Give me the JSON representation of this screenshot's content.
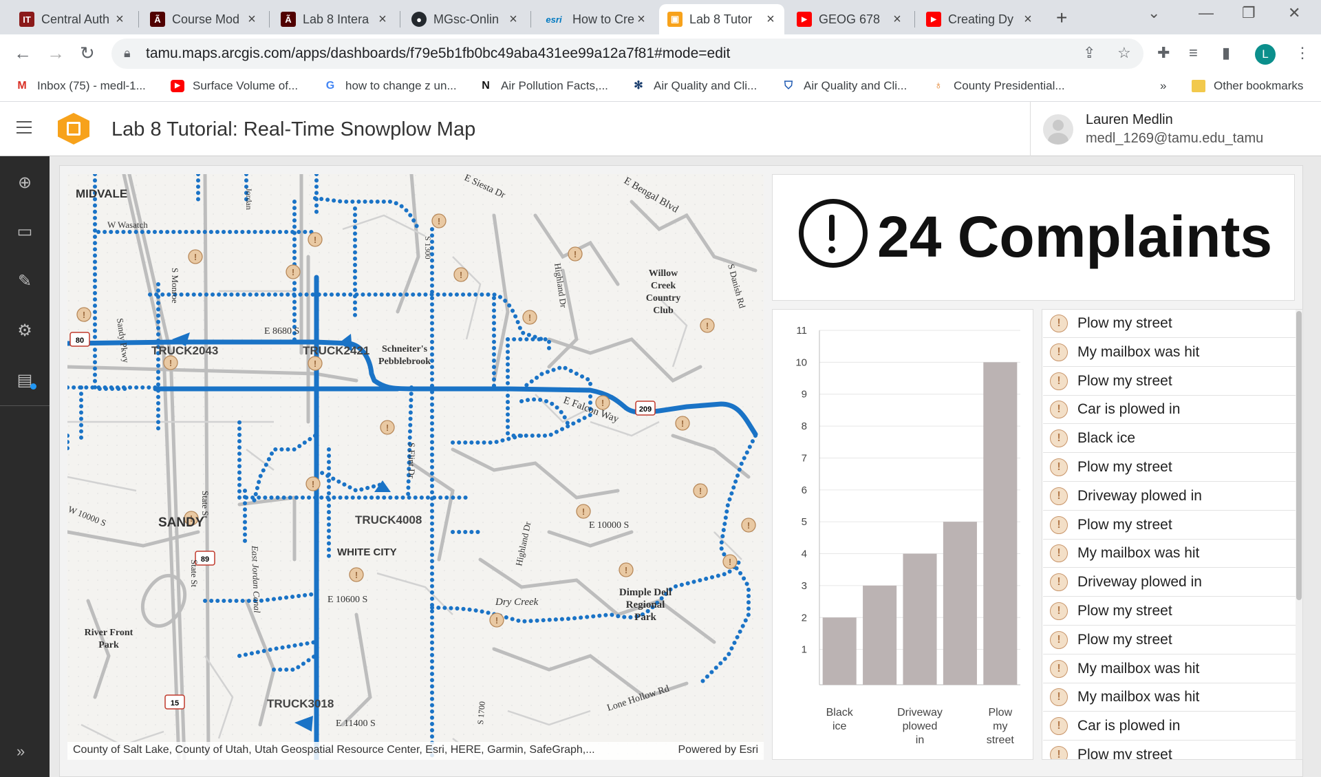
{
  "browser": {
    "tabs": [
      {
        "label": "Central Auth",
        "icon": "it-icon",
        "color": "#8b1a1a"
      },
      {
        "label": "Course Mod",
        "icon": "tamu-icon",
        "color": "#500000"
      },
      {
        "label": "Lab 8 Intera",
        "icon": "tamu-icon",
        "color": "#500000"
      },
      {
        "label": "MGsc-Onlin",
        "icon": "github-icon",
        "color": "#24292e"
      },
      {
        "label": "How to Cre",
        "icon": "esri-icon",
        "color": "#0079c1"
      },
      {
        "label": "Lab 8 Tutor",
        "icon": "dashboards-icon",
        "color": "#f7a21b"
      },
      {
        "label": "GEOG 678",
        "icon": "youtube-icon",
        "color": "#ff0000"
      },
      {
        "label": "Creating Dy",
        "icon": "youtube-icon",
        "color": "#ff0000"
      }
    ],
    "url": "tamu.maps.arcgis.com/apps/dashboards/f79e5b1fb0bc49aba431ee99a12a7f81#mode=edit",
    "profile_initial": "L",
    "bookmarks": [
      {
        "label": "Inbox (75) - medl-1...",
        "icon": "gmail-icon"
      },
      {
        "label": "Surface Volume of...",
        "icon": "youtube-icon"
      },
      {
        "label": "how to change z un...",
        "icon": "google-icon"
      },
      {
        "label": "Air Pollution Facts,...",
        "icon": "n-icon"
      },
      {
        "label": "Air Quality and Cli...",
        "icon": "snowflake-icon"
      },
      {
        "label": "Air Quality and Cli...",
        "icon": "shield-icon"
      },
      {
        "label": "County Presidential...",
        "icon": "pin-icon"
      }
    ],
    "bookmarks_overflow": "»",
    "other_bookmarks": "Other bookmarks"
  },
  "app": {
    "title": "Lab 8 Tutorial: Real-Time Snowplow Map",
    "user_name": "Lauren Medlin",
    "user_email": "medl_1269@tamu.edu_tamu"
  },
  "map": {
    "labels": {
      "midvale": "MIDVALE",
      "sandy": "SANDY",
      "white_city": "WHITE CITY",
      "willow": "Willow Creek Country Club",
      "schneiter": "Schneiter's Pebblebrook",
      "dimple": "Dimple Dell Regional Park",
      "riverfront": "River Front Park",
      "dry_creek": "Dry Creek",
      "e_siesta": "E Siesta Dr",
      "e_bengal": "E Bengal Blvd",
      "e_falcon": "E Falcon Way",
      "e_8680": "E 8680 S",
      "e_10000": "E 10000 S",
      "e_10600": "E 10600 S",
      "e_11400": "E 11400 S",
      "w_10000": "W 10000 S",
      "lone_hollow": "Lone Hollow Rd",
      "highland": "Highland Dr",
      "highland2": "Highland Dr",
      "state_st": "State St",
      "state_st2": "State St",
      "e_jordan": "East Jordan Canal",
      "s_monroe": "S Monroe",
      "s_flint": "S Flint Dr",
      "s_danish": "S Danish Rd",
      "sandy_pkwy": "Sandy Pkwy",
      "w_wasatch": "W Wasatch"
    },
    "trucks": [
      "TRUCK2043",
      "TRUCK2421",
      "TRUCK4008",
      "TRUCK3018"
    ],
    "shields": [
      "80",
      "209",
      "89",
      "15"
    ],
    "attribution": "County of Salt Lake, County of Utah, Utah Geospatial Resource Center, Esri, HERE, Garmin, SafeGraph,...",
    "powered_by": "Powered by Esri",
    "colors": {
      "route": "#1a73c6",
      "complaint": "#e9c9a3"
    }
  },
  "indicator": {
    "value": "24",
    "label": "Complaints",
    "text": "24 Complaints"
  },
  "chart_data": {
    "type": "bar",
    "categories": [
      "Black ice",
      "Car is plowed in",
      "Driveway plowed in",
      "My mailbox was hit",
      "Plow my street"
    ],
    "category_tick_labels": [
      "Black ice",
      "",
      "Driveway plowed in",
      "",
      "Plow my street"
    ],
    "values": [
      2,
      3,
      4,
      5,
      10
    ],
    "ylim": [
      0,
      11
    ],
    "yticks": [
      1,
      2,
      3,
      4,
      5,
      6,
      7,
      8,
      9,
      10,
      11
    ],
    "bar_color": "#bbb3b3",
    "grid": true
  },
  "list": {
    "items": [
      "Plow my street",
      "My mailbox was hit",
      "Plow my street",
      "Car is plowed in",
      "Black ice",
      "Plow my street",
      "Driveway plowed in",
      "Plow my street",
      "My mailbox was hit",
      "Driveway plowed in",
      "Plow my street",
      "Plow my street",
      "My mailbox was hit",
      "My mailbox was hit",
      "Car is plowed in",
      "Plow my street"
    ]
  }
}
